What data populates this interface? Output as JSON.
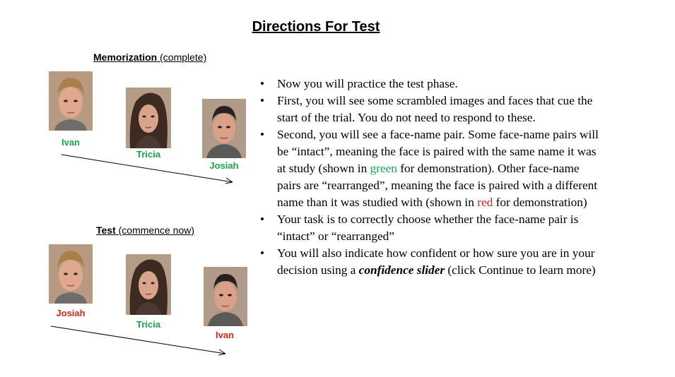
{
  "title": "Directions For Test",
  "memorization": {
    "heading_bold": "Memorization",
    "heading_rest": " (complete)",
    "names": [
      "Ivan",
      "Tricia",
      "Josiah"
    ]
  },
  "test": {
    "heading_bold": "Test",
    "heading_rest": " (commence now)",
    "names": [
      "Josiah",
      "Tricia",
      "Ivan"
    ]
  },
  "bullets": {
    "b1": "Now you will practice the test phase.",
    "b2": "First, you will see some scrambled images and faces that cue the start of the trial. You do not need to respond to these.",
    "b3_part1": "Second, you will see a face-name pair. Some face-name pairs will be “intact”, meaning the face is paired with the same name it was at study (shown in ",
    "b3_green": "green",
    "b3_part2": " for demonstration). Other face-name pairs are “rearranged”, meaning the face is paired with a different name than it was studied with (shown in ",
    "b3_red": "red",
    "b3_part3": " for demonstration)",
    "b4": "Your task is to correctly choose whether the face-name pair is “intact” or “rearranged”",
    "b5_part1": "You will also indicate how confident or how sure you are in your decision using a ",
    "b5_em": "confidence slider",
    "b5_part2": " (click Continue to learn more)"
  },
  "colors": {
    "intact": "#1aa64a",
    "rearranged": "#d9261c"
  }
}
